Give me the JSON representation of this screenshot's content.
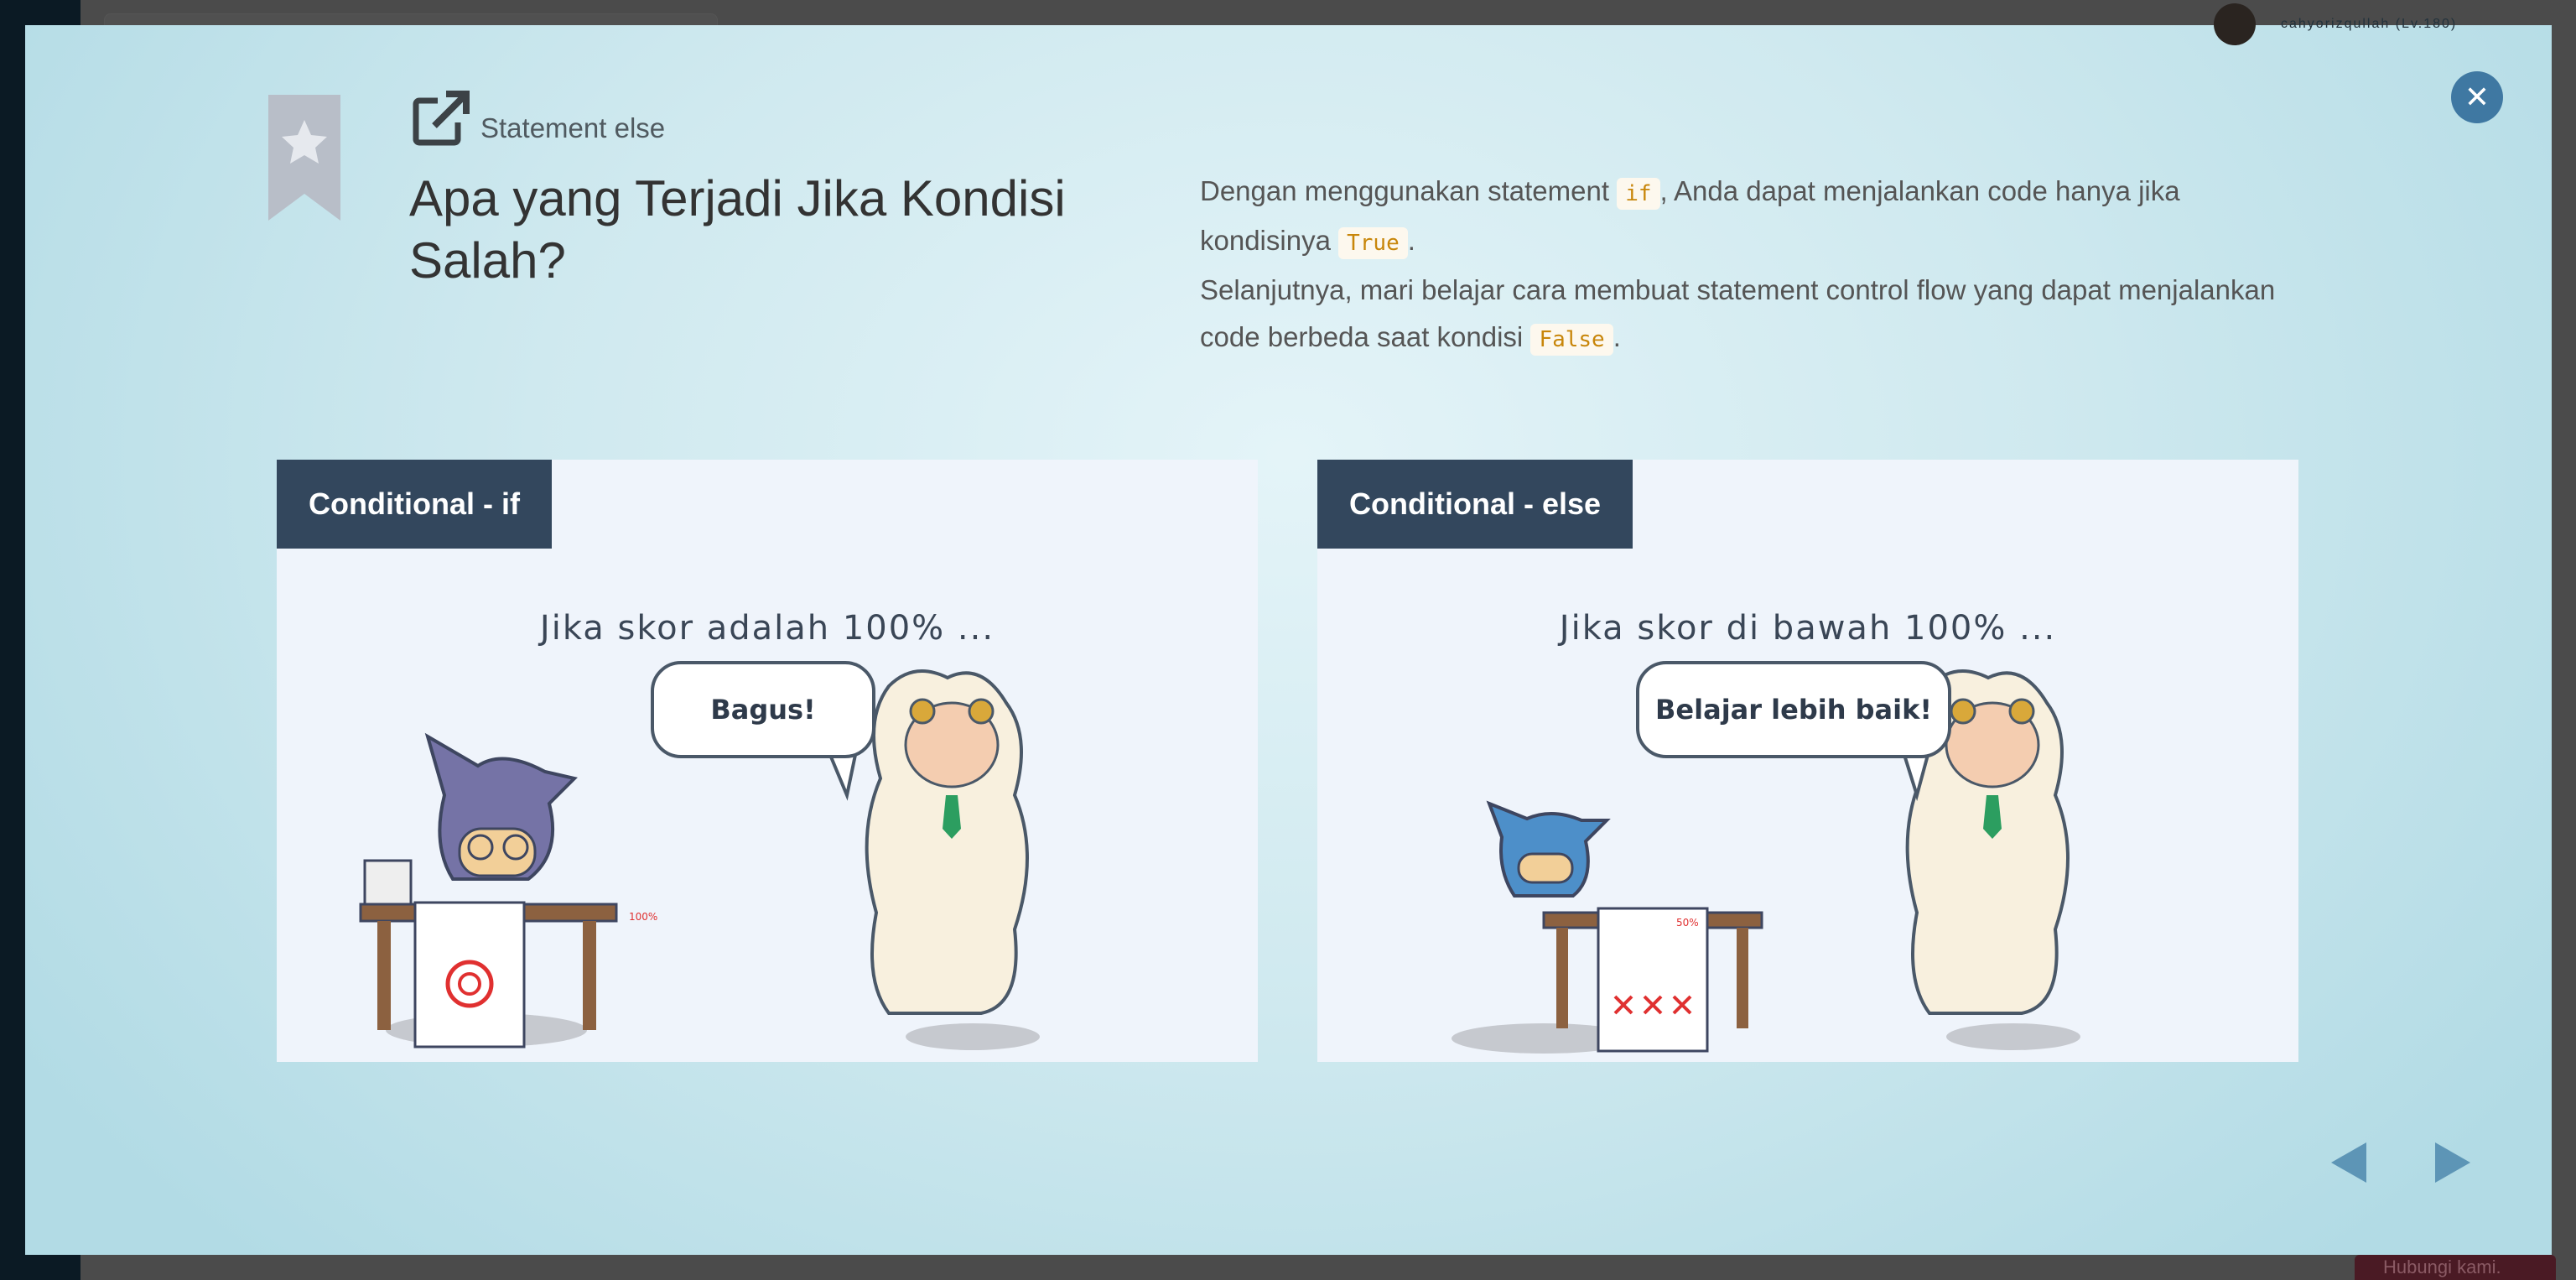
{
  "background": {
    "username": "cahyorizqullah (Lv.180)",
    "contact_label": "Hubungi kami."
  },
  "modal": {
    "subtitle": "Statement else",
    "title": "Apa yang Terjadi Jika Kondisi Salah?",
    "paragraph": {
      "line1_a": "Dengan menggunakan statement ",
      "code_if": "if",
      "line1_b": ", Anda dapat menjalankan code hanya jika kondisinya ",
      "code_true": "True",
      "line1_c": ".",
      "line2_a": "Selanjutnya, mari belajar cara membuat statement control flow yang dapat menjalankan code berbeda saat kondisi ",
      "code_false": "False",
      "line2_b": "."
    },
    "panels": [
      {
        "tab": "Conditional - if",
        "caption": "Jika skor adalah 100% ...",
        "speech": "Bagus!",
        "score": "100%"
      },
      {
        "tab": "Conditional - else",
        "caption": "Jika skor di bawah 100% ...",
        "speech": "Belajar lebih baik!",
        "score": "50%"
      }
    ]
  },
  "colors": {
    "accent": "#3f78a2",
    "nav_arrow": "#5d95b6",
    "tab_bg": "#33475d",
    "code": "#c8860a"
  }
}
